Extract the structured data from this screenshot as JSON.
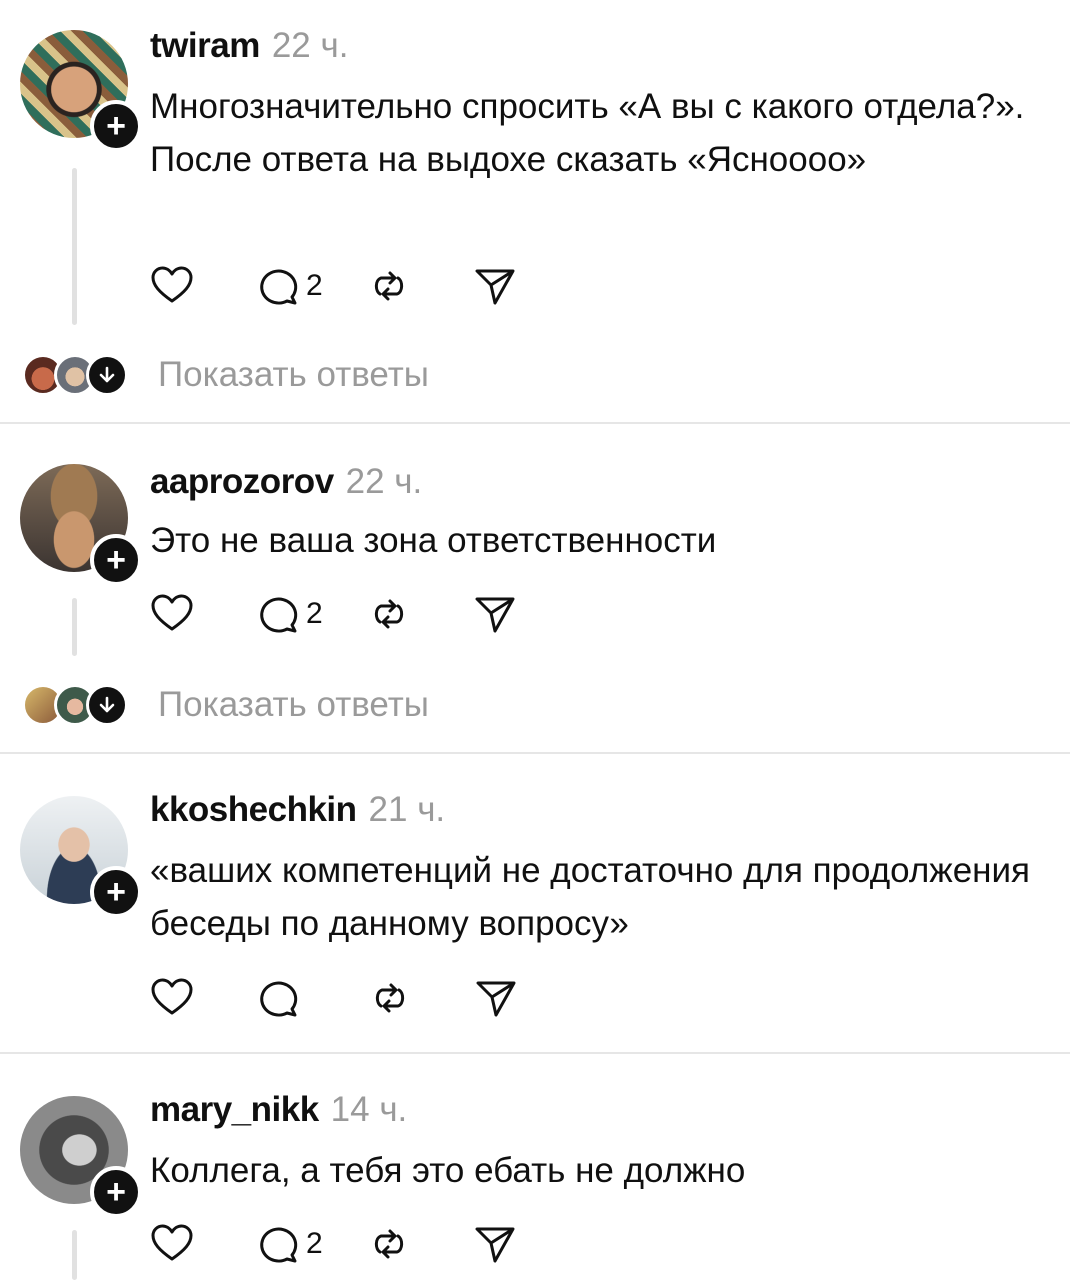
{
  "posts": [
    {
      "username": "twiram",
      "time": "22 ч.",
      "text": "Многозначительно спросить «А вы с какого отдела?». После ответа на выдохе сказать «Яснoooo»",
      "reply_count": "2",
      "show_replies": "Показать ответы"
    },
    {
      "username": "aaprozorov",
      "time": "22 ч.",
      "text": "Это не ваша зона ответственности",
      "reply_count": "2",
      "show_replies": "Показать ответы"
    },
    {
      "username": "kkoshechkin",
      "time": "21 ч.",
      "text": "«ваших компетенций не достаточно для продолжения беседы по данному вопросу»",
      "reply_count": ""
    },
    {
      "username": "mary_nikk",
      "time": "14 ч.",
      "text": "Коллега, а тебя это ебать не должно",
      "reply_count": "2"
    }
  ],
  "icons": [
    "heart-icon",
    "comment-icon",
    "repost-icon",
    "share-icon",
    "plus-icon",
    "arrow-down-icon"
  ]
}
